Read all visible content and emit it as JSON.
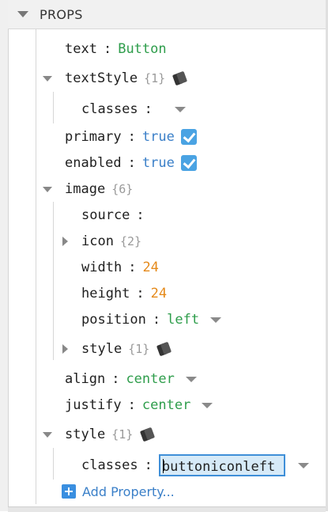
{
  "panel": {
    "title": "PROPS"
  },
  "props": {
    "text": {
      "key": "text",
      "value": "Button"
    },
    "textStyle": {
      "key": "textStyle",
      "count": "{1}",
      "classes_key": "classes"
    },
    "primary": {
      "key": "primary",
      "value": "true"
    },
    "enabled": {
      "key": "enabled",
      "value": "true"
    },
    "image": {
      "key": "image",
      "count": "{6}",
      "source_key": "source",
      "icon_key": "icon",
      "icon_count": "{2}",
      "width_key": "width",
      "width_value": "24",
      "height_key": "height",
      "height_value": "24",
      "position_key": "position",
      "position_value": "left",
      "style_key": "style",
      "style_count": "{1}"
    },
    "align": {
      "key": "align",
      "value": "center"
    },
    "justify": {
      "key": "justify",
      "value": "center"
    },
    "style": {
      "key": "style",
      "count": "{1}",
      "classes_key": "classes",
      "classes_value": "buttoniconleft"
    }
  },
  "add_property_label": "Add Property..."
}
